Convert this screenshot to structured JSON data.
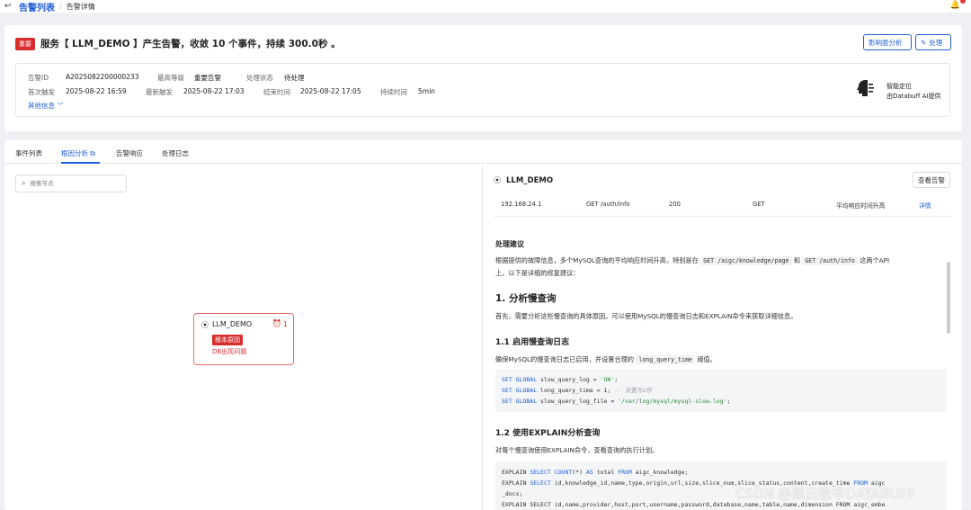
{
  "breadcrumb": {
    "main": "告警列表",
    "sep": "/",
    "sub": "告警详情"
  },
  "alert": {
    "severity_tag": "重要",
    "title": "服务【 LLM_DEMO 】产生告警，收敛 10 个事件，持续 300.0秒 。",
    "buttons": {
      "impact": "影响面分析",
      "handle": "处理"
    },
    "fields": {
      "id_label": "告警ID",
      "id_value": "A2025082200000233",
      "level_label": "最高等级",
      "level_value": "重要告警",
      "status_label": "处理状态",
      "status_value": "待处理",
      "first_label": "首次触发",
      "first_value": "2025-08-22 16:59",
      "latest_label": "最新触发",
      "latest_value": "2025-08-22 17:03",
      "end_label": "结束时间",
      "end_value": "2025-08-22 17:05",
      "duration_label": "持续时间",
      "duration_value": "5min"
    },
    "more_info": "其他信息",
    "ai": {
      "line1": "智能定位",
      "line2": "由Databuff AI提供"
    }
  },
  "tabs": [
    "事件列表",
    "根因分析",
    "告警响应",
    "处理日志"
  ],
  "search": {
    "placeholder": "搜索节点"
  },
  "node": {
    "name": "LLM_DEMO",
    "alert_count": "1",
    "root_tag": "根本原因",
    "root_desc": "DB出现问题"
  },
  "detail": {
    "service": "LLM_DEMO",
    "view_button": "查看告警",
    "row": {
      "ip": "192.168.24.1",
      "endpoint": "GET /auth/info",
      "code": "200",
      "method": "GET",
      "issue": "平均响应时间升高",
      "link": "详情"
    },
    "section_label": "处理建议",
    "intro_a": "根据提供的故障信息，多个MySQL查询的平均响应时间升高，特别是在",
    "intro_code1": "GET /aigc/knowledge/page",
    "intro_and": "和",
    "intro_code2": "GET /auth/info",
    "intro_b": "这两个API",
    "intro_c": "上。以下是详细的修复建议：",
    "h1": "1. 分析慢查询",
    "h1_para": "首先，需要分析这些慢查询的具体原因。可以使用MySQL的慢查询日志和EXPLAIN命令来获取详细信息。",
    "h2a": "1.1 启用慢查询日志",
    "h2a_para_a": "确保MySQL的慢查询日志已启用，并设置合理的",
    "h2a_para_code": "long_query_time",
    "h2a_para_b": "阈值。",
    "code1": {
      "l1_kw": "SET GLOBAL",
      "l1_rest": " slow_query_log = ",
      "l1_str": "'ON'",
      "l1_end": ";",
      "l2_kw": "SET GLOBAL",
      "l2_rest": " long_query_time = 1; ",
      "l2_cmt": "-- 设置为1秒",
      "l3_kw": "SET GLOBAL",
      "l3_rest": " slow_query_log_file = ",
      "l3_str": "'/var/log/mysql/mysql-slow.log'",
      "l3_end": ";"
    },
    "h2b": "1.2 使用EXPLAIN分析查询",
    "h2b_para": "对每个慢查询使用EXPLAIN命令，查看查询的执行计划。",
    "code2": {
      "l1_a": "EXPLAIN ",
      "l1_kw": "SELECT",
      "l1_b": " ",
      "l1_fn": "COUNT",
      "l1_c": "(*) ",
      "l1_kw2": "AS",
      "l1_d": " total ",
      "l1_kw3": "FROM",
      "l1_e": " aigc_knowledge;",
      "l2_a": "EXPLAIN ",
      "l2_kw": "SELECT",
      "l2_b": " id,knowledge_id,name,type,origin,url,size,slice_num,slice_status,content,create_time ",
      "l2_kw2": "FROM",
      "l2_c": " aigc",
      "l3": "_docs;",
      "l4": "EXPLAIN SELECT id,name,provider,host,port,username,password,database,name,table,name,dimension FROM aigc_embe"
    }
  },
  "watermark": "CSDN @乘云数字DATABUFF"
}
